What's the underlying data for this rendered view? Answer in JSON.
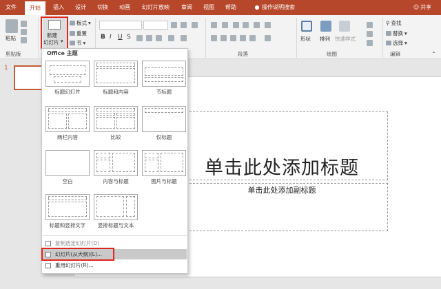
{
  "tabs": [
    "文件",
    "开始",
    "插入",
    "设计",
    "切换",
    "动画",
    "幻灯片放映",
    "审阅",
    "视图",
    "帮助"
  ],
  "tell_me": "操作说明搜索",
  "share": "共享",
  "ribbon": {
    "paste": "粘贴",
    "new_slide_line1": "新建",
    "new_slide_line2": "幻灯片",
    "layout": "板式",
    "reset": "重置",
    "section": "节",
    "shapes": "形状",
    "arrange": "排列",
    "quick_styles": "快速样式",
    "find": "查找",
    "replace": "替换",
    "select": "选择",
    "groups": {
      "clipboard": "剪贴板",
      "paragraph": "段落",
      "drawing": "绘图",
      "editing": "编辑"
    }
  },
  "slide_number": "1",
  "slide": {
    "title": "单击此处添加标题",
    "subtitle": "单击此处添加副标题"
  },
  "menu": {
    "header": "Office 主题",
    "layouts": [
      "标题幻灯片",
      "标题和内容",
      "节标题",
      "两栏内容",
      "比较",
      "仅标题",
      "空白",
      "内容与标题",
      "图片与标题",
      "标题和竖排文字",
      "竖排标题与文本"
    ],
    "items": [
      "复制选定幻灯片(D)",
      "幻灯片(从大纲)(L)...",
      "重用幻灯片(R)..."
    ]
  }
}
